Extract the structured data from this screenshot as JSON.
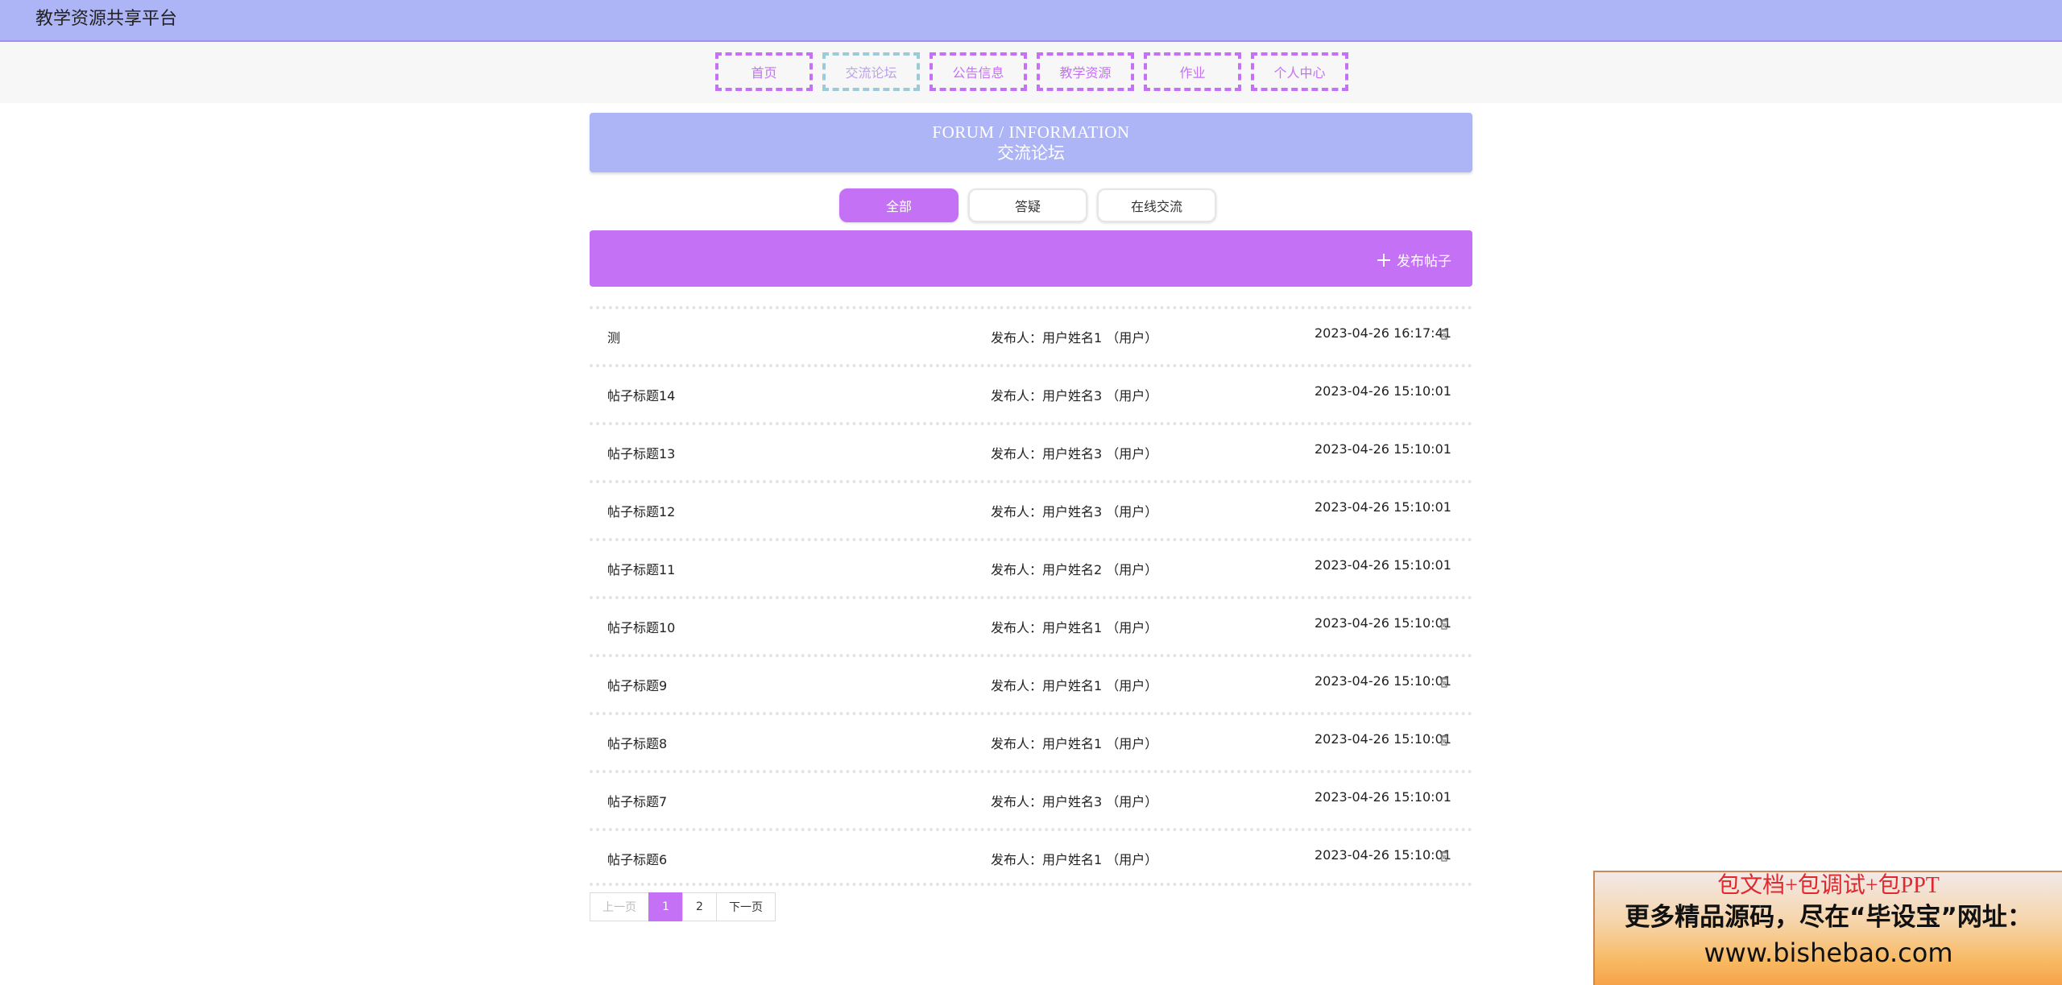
{
  "app": {
    "title": "教学资源共享平台"
  },
  "nav": {
    "items": [
      {
        "label": "首页"
      },
      {
        "label": "交流论坛"
      },
      {
        "label": "公告信息"
      },
      {
        "label": "教学资源"
      },
      {
        "label": "作业"
      },
      {
        "label": "个人中心"
      }
    ],
    "active_index": 1
  },
  "banner": {
    "en": "FORUM / INFORMATION",
    "cn": "交流论坛"
  },
  "filters": [
    {
      "label": "全部",
      "active": true
    },
    {
      "label": "答疑",
      "active": false
    },
    {
      "label": "在线交流",
      "active": false
    }
  ],
  "post_button": {
    "label": "发布帖子",
    "icon": "plus-icon"
  },
  "posts": [
    {
      "title": "测",
      "author": "发布人：用户姓名1 （用户）",
      "time": "2023-04-26 16:17:41",
      "deletable": true
    },
    {
      "title": "帖子标题14",
      "author": "发布人：用户姓名3 （用户）",
      "time": "2023-04-26 15:10:01",
      "deletable": false
    },
    {
      "title": "帖子标题13",
      "author": "发布人：用户姓名3 （用户）",
      "time": "2023-04-26 15:10:01",
      "deletable": false
    },
    {
      "title": "帖子标题12",
      "author": "发布人：用户姓名3 （用户）",
      "time": "2023-04-26 15:10:01",
      "deletable": false
    },
    {
      "title": "帖子标题11",
      "author": "发布人：用户姓名2 （用户）",
      "time": "2023-04-26 15:10:01",
      "deletable": false
    },
    {
      "title": "帖子标题10",
      "author": "发布人：用户姓名1 （用户）",
      "time": "2023-04-26 15:10:01",
      "deletable": true
    },
    {
      "title": "帖子标题9",
      "author": "发布人：用户姓名1 （用户）",
      "time": "2023-04-26 15:10:01",
      "deletable": true
    },
    {
      "title": "帖子标题8",
      "author": "发布人：用户姓名1 （用户）",
      "time": "2023-04-26 15:10:01",
      "deletable": true
    },
    {
      "title": "帖子标题7",
      "author": "发布人：用户姓名3 （用户）",
      "time": "2023-04-26 15:10:01",
      "deletable": false
    },
    {
      "title": "帖子标题6",
      "author": "发布人：用户姓名1 （用户）",
      "time": "2023-04-26 15:10:01",
      "deletable": true
    }
  ],
  "pagination": {
    "prev": "上一页",
    "pages": [
      "1",
      "2"
    ],
    "current": "1",
    "next": "下一页"
  },
  "ad": {
    "line1": "包文档+包调试+包PPT",
    "line2": "更多精品源码，尽在“毕设宝”网址：",
    "line3": "www.bishebao.com"
  },
  "colors": {
    "accent": "#c471f5",
    "header": "#adb5f7"
  }
}
